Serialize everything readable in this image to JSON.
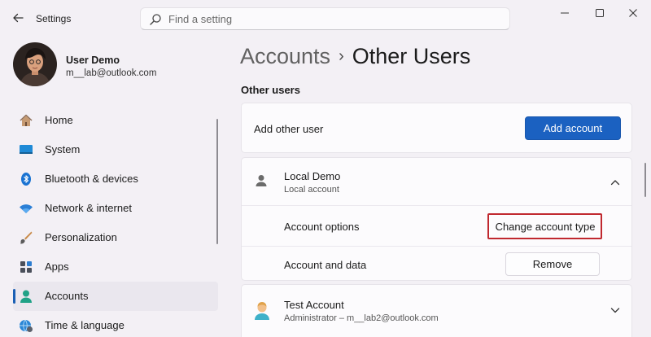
{
  "window": {
    "title": "Settings",
    "back_icon": "back-arrow-icon",
    "controls": [
      "minimize-icon",
      "maximize-icon",
      "close-icon"
    ]
  },
  "search": {
    "placeholder": "Find a setting"
  },
  "profile": {
    "name": "User Demo",
    "email": "m__lab@outlook.com"
  },
  "sidebar": {
    "items": [
      {
        "label": "Home",
        "icon": "home-icon"
      },
      {
        "label": "System",
        "icon": "system-icon"
      },
      {
        "label": "Bluetooth & devices",
        "icon": "bluetooth-icon"
      },
      {
        "label": "Network & internet",
        "icon": "wifi-icon"
      },
      {
        "label": "Personalization",
        "icon": "brush-icon"
      },
      {
        "label": "Apps",
        "icon": "apps-icon"
      },
      {
        "label": "Accounts",
        "icon": "person-icon",
        "active": true
      },
      {
        "label": "Time & language",
        "icon": "globe-clock-icon"
      }
    ]
  },
  "main": {
    "breadcrumb": {
      "parent": "Accounts",
      "current": "Other Users"
    },
    "section_title": "Other users",
    "add_user": {
      "label": "Add other user",
      "button": "Add account"
    },
    "local_account": {
      "name": "Local Demo",
      "type": "Local account",
      "options_label": "Account options",
      "options_button": "Change account type",
      "data_label": "Account and data",
      "data_button": "Remove"
    },
    "test_account": {
      "name": "Test Account",
      "detail": "Administrator – m__lab2@outlook.com"
    }
  },
  "colors": {
    "accent": "#1b61c1",
    "highlight": "#c0282f",
    "background": "#f3f0f5"
  }
}
